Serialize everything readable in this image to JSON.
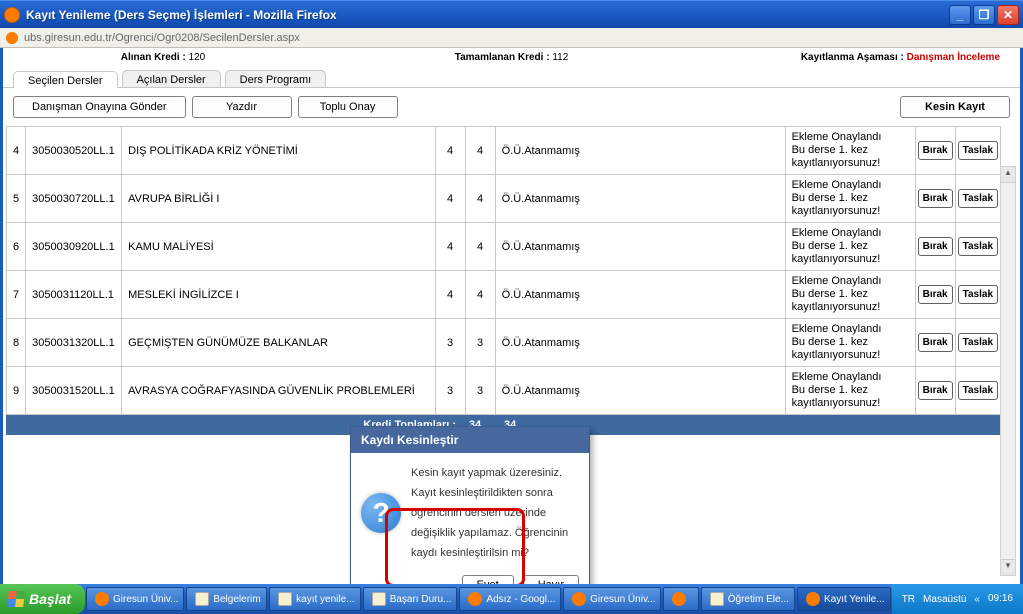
{
  "window": {
    "title": "Kayıt Yenileme (Ders Seçme) İşlemleri - Mozilla Firefox",
    "url": "ubs.giresun.edu.tr/Ogrenci/Ogr0208/SecilenDersler.aspx"
  },
  "info": {
    "alinan_label": "Alınan Kredi :",
    "alinan_value": "120",
    "tamam_label": "Tamamlanan Kredi :",
    "tamam_value": "112",
    "asama_label": "Kayıtlanma Aşaması :",
    "asama_value": "Danışman İnceleme"
  },
  "tabs": {
    "t1": "Seçilen Dersler",
    "t2": "Açılan Dersler",
    "t3": "Ders Programı"
  },
  "actions": {
    "danisman": "Danışman Onayına Gönder",
    "yazdir": "Yazdır",
    "toplu": "Toplu Onay",
    "kesin": "Kesin Kayıt",
    "birak": "Bırak",
    "taslak": "Taslak"
  },
  "rows": [
    {
      "n": "4",
      "code": "3050030520LL.1",
      "name": "DIŞ POLİTİKADA KRİZ YÖNETİMİ",
      "k1": "4",
      "k2": "4",
      "inst": "Ö.Ü.Atanmamış"
    },
    {
      "n": "5",
      "code": "3050030720LL.1",
      "name": "AVRUPA BİRLİĞİ I",
      "k1": "4",
      "k2": "4",
      "inst": "Ö.Ü.Atanmamış"
    },
    {
      "n": "6",
      "code": "3050030920LL.1",
      "name": "KAMU MALİYESİ",
      "k1": "4",
      "k2": "4",
      "inst": "Ö.Ü.Atanmamış"
    },
    {
      "n": "7",
      "code": "3050031120LL.1",
      "name": "MESLEKİ İNGİLİZCE I",
      "k1": "4",
      "k2": "4",
      "inst": "Ö.Ü.Atanmamış"
    },
    {
      "n": "8",
      "code": "3050031320LL.1",
      "name": "GEÇMİŞTEN GÜNÜMÜZE BALKANLAR",
      "k1": "3",
      "k2": "3",
      "inst": "Ö.Ü.Atanmamış"
    },
    {
      "n": "9",
      "code": "3050031520LL.1",
      "name": "AVRASYA COĞRAFYASINDA GÜVENLİK PROBLEMLERİ",
      "k1": "3",
      "k2": "3",
      "inst": "Ö.Ü.Atanmamış"
    }
  ],
  "status_text": "Ekleme Onaylandı\nBu derse 1. kez kayıtlanıyorsunuz!",
  "totals": {
    "label": "Kredi Toplamları :",
    "v1": "34",
    "v2": "34"
  },
  "dialog": {
    "title": "Kaydı Kesinleştir",
    "msg": "Kesin kayıt yapmak üzeresiniz. Kayıt kesinleştirildikten sonra öğrencinin dersleri üzerinde değişiklik yapılamaz. Öğrencinin kaydı kesinleştirilsin mi?",
    "yes": "Evet",
    "no": "Hayır"
  },
  "taskbar": {
    "start": "Başlat",
    "items": [
      "Giresun Üniv...",
      "Belgelerim",
      "kayıt yenile...",
      "Başarı Duru...",
      "Adsız - Googl...",
      "Giresun Üniv...",
      "",
      "Öğretim Ele...",
      "Kayıt Yenile..."
    ],
    "lang": "TR",
    "desk": "Masaüstü",
    "time": "09:16"
  }
}
